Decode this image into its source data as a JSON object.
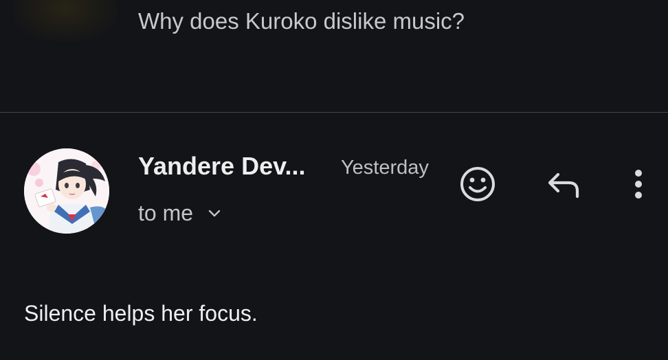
{
  "previous_message": {
    "snippet": "Why does Kuroko dislike music?"
  },
  "message": {
    "sender_name": "Yandere Dev...",
    "timestamp": "Yesterday",
    "recipient_label": "to me",
    "body": "Silence helps her focus."
  },
  "icons": {
    "emoji": "smiley-face-icon",
    "reply": "reply-arrow-icon",
    "more": "more-vertical-icon",
    "expand": "chevron-down-icon"
  },
  "colors": {
    "background": "#131418",
    "divider": "#47484c",
    "text_primary": "#eeeeee",
    "text_secondary": "#bfc0c4"
  }
}
